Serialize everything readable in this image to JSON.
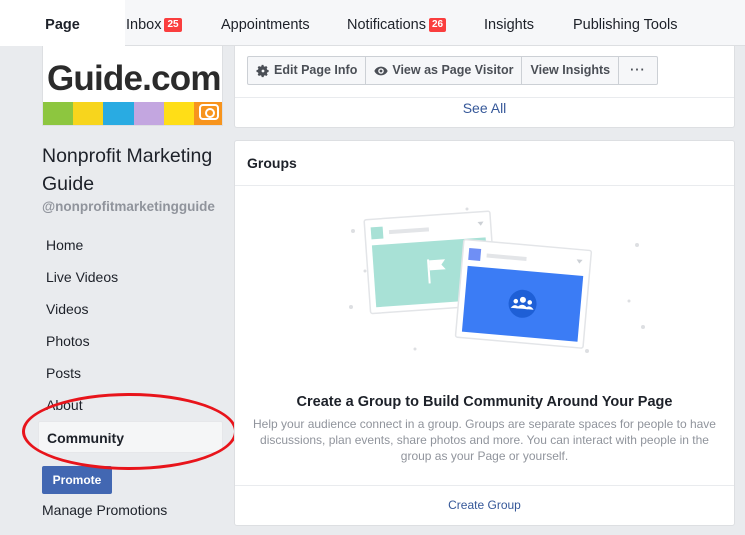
{
  "topnav": {
    "tabs": [
      {
        "label": "Page",
        "active": true
      },
      {
        "label": "Inbox",
        "badge": "25"
      },
      {
        "label": "Appointments"
      },
      {
        "label": "Notifications",
        "badge": "26"
      },
      {
        "label": "Insights"
      },
      {
        "label": "Publishing Tools"
      }
    ]
  },
  "logo": {
    "text": "Guide.com",
    "strip_colors": [
      "#8dc63f",
      "#f7d51d",
      "#29abe2",
      "#c3a6e0",
      "#ffde17",
      "#f7941d"
    ]
  },
  "page": {
    "name": "Nonprofit Marketing Guide",
    "handle": "@nonprofitmarketingguide"
  },
  "sidenav": {
    "items": [
      {
        "label": "Home"
      },
      {
        "label": "Live Videos"
      },
      {
        "label": "Videos"
      },
      {
        "label": "Photos"
      },
      {
        "label": "Posts"
      },
      {
        "label": "About"
      },
      {
        "label": "Community",
        "active": true
      }
    ],
    "promote_label": "Promote",
    "manage_promotions_label": "Manage Promotions"
  },
  "actions": {
    "edit_page_info": "Edit Page Info",
    "view_as_visitor": "View as Page Visitor",
    "view_insights": "View Insights",
    "more": "···",
    "see_all": "See All"
  },
  "groups": {
    "header": "Groups",
    "title": "Create a Group to Build Community Around Your Page",
    "description": "Help your audience connect in a group. Groups are separate spaces for people to have discussions, plan events, share photos and more. You can interact with people in the group as your Page or yourself.",
    "create_label": "Create Group"
  },
  "colors": {
    "brand_blue": "#4267b2",
    "link_blue": "#365899",
    "badge_red": "#fa3e3e",
    "annotation_red": "#e8141b",
    "illus_teal": "#a8e1d6",
    "illus_blue": "#3b7cf5"
  }
}
